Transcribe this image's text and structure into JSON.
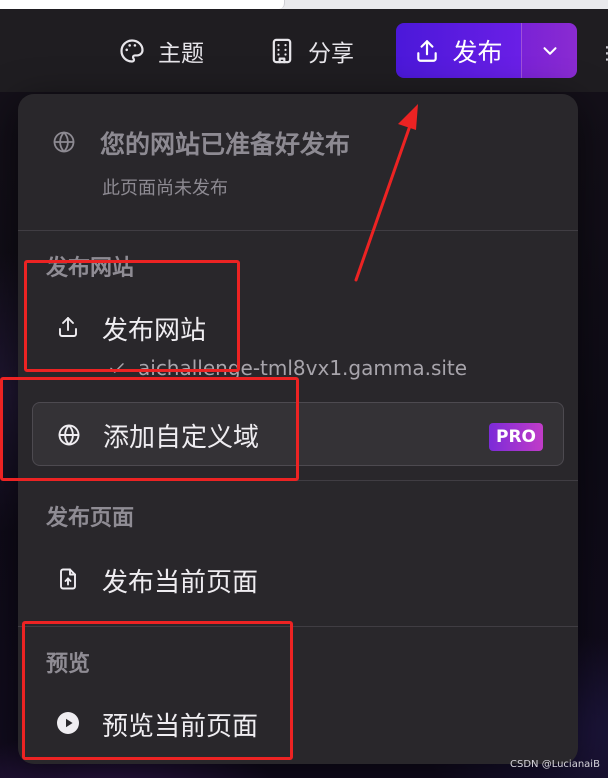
{
  "toolbar": {
    "theme_label": "主题",
    "share_label": "分享",
    "publish_label": "发布",
    "more_glyph": "⋮"
  },
  "menu": {
    "status": {
      "title": "您的网站已准备好发布",
      "subtitle": "此页面尚未发布"
    },
    "sections": [
      {
        "label": "发布网站",
        "items": [
          {
            "label": "发布网站",
            "icon": "upload-icon"
          }
        ],
        "url": "aichallenge-tml8vx1.gamma.site",
        "custom_domain": {
          "label": "添加自定义域",
          "icon": "globe-icon",
          "badge": "PRO"
        }
      },
      {
        "label": "发布页面",
        "items": [
          {
            "label": "发布当前页面",
            "icon": "file-upload-icon"
          }
        ]
      },
      {
        "label": "预览",
        "items": [
          {
            "label": "预览当前页面",
            "icon": "play-icon"
          }
        ]
      }
    ]
  },
  "colors": {
    "accent_start": "#4b18d9",
    "accent_end": "#8a2bd1",
    "pro_badge": "#c13cc8",
    "annotation": "#ec2323"
  },
  "watermark": "CSDN @LucianaiB"
}
